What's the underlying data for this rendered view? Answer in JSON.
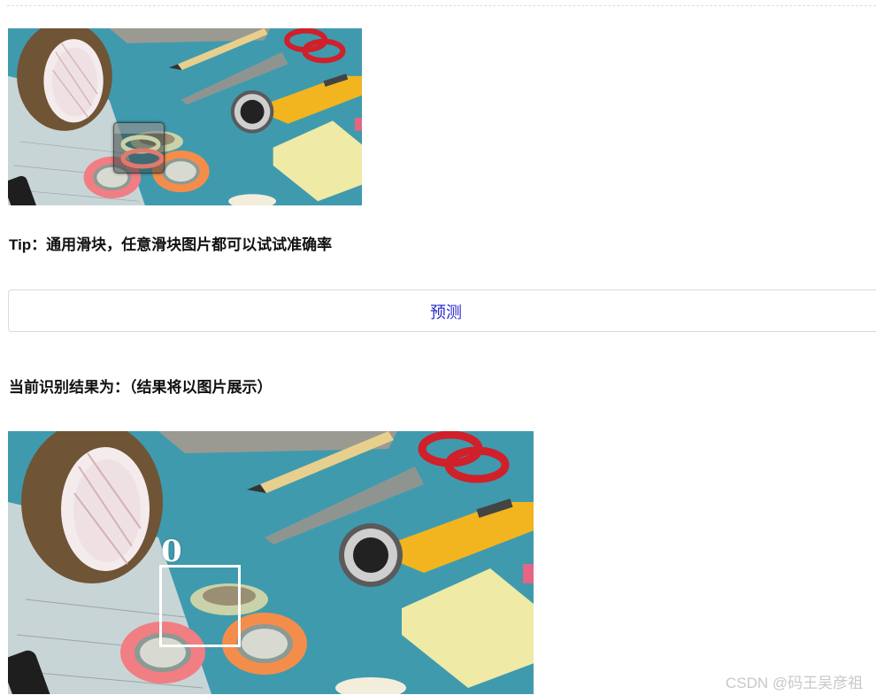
{
  "tip_text": "Tip：通用滑块，任意滑块图片都可以试试准确率",
  "predict_button_label": "预测",
  "result_heading": "当前识别结果为：（结果将以图片展示）",
  "detection_label": "0",
  "watermark": "CSDN @码王吴彦祖",
  "colors": {
    "button_text": "#2b2bcf",
    "scene_background": "#3f9aae",
    "scissor_handle": "#d0202a",
    "cutter_body": "#f2b51f",
    "sticky_note": "#efeaa5",
    "tape_pink": "#f07e83",
    "tape_orange": "#f58d4a",
    "detect_box": "#ffffff"
  }
}
